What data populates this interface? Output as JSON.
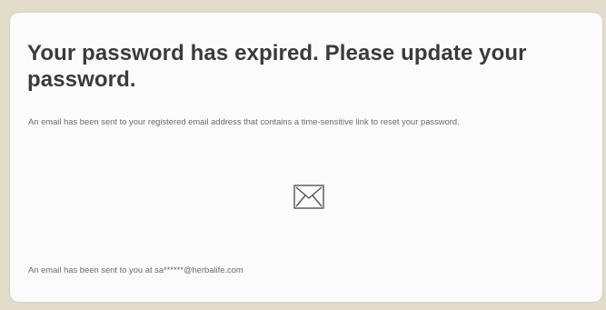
{
  "dialog": {
    "title": "Your password has expired. Please update your password.",
    "description": "An email has been sent to your registered email address that contains a time-sensitive link to reset your password.",
    "icon": "envelope-icon",
    "sent_message": "An email has been sent to you at sa******@herbalife.com"
  },
  "colors": {
    "background": "#e2dccb",
    "card": "#fbfbfb",
    "title_text": "#3b3b3b",
    "body_text": "#6b6b6b",
    "icon_stroke": "#555555"
  }
}
